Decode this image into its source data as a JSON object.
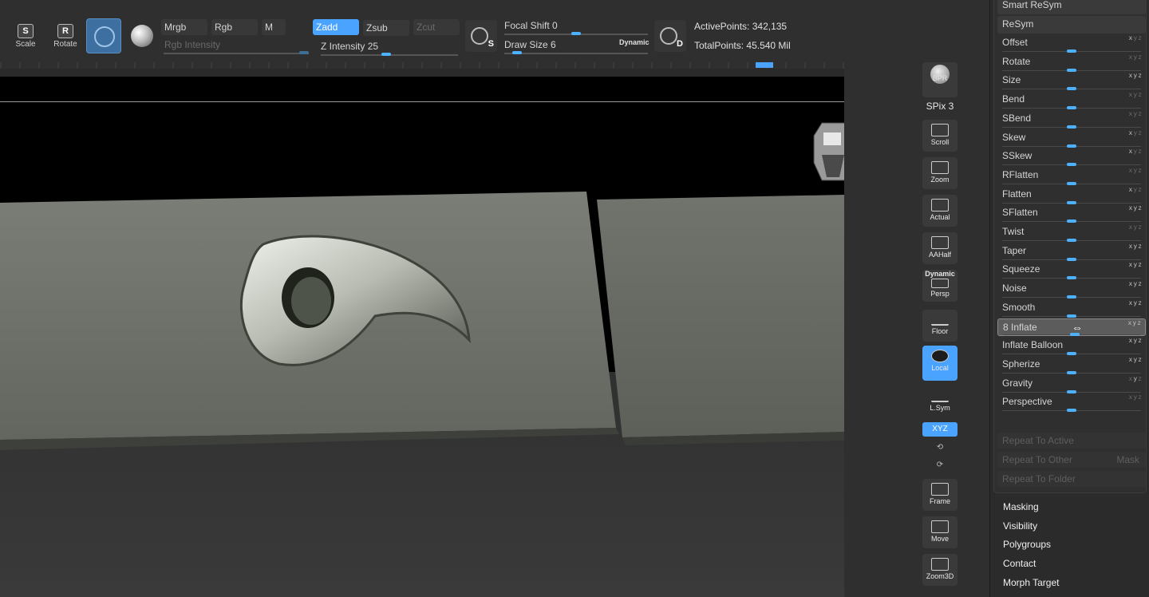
{
  "toolbar": {
    "scale_label": "Scale",
    "scale_glyph": "S",
    "rotate_label": "Rotate",
    "rotate_glyph": "R",
    "mrgb": "Mrgb",
    "rgb": "Rgb",
    "m": "M",
    "rgb_intensity": "Rgb Intensity",
    "zadd": "Zadd",
    "zsub": "Zsub",
    "zcut": "Zcut",
    "z_intensity_label": "Z Intensity",
    "z_intensity_value": "25",
    "focal_shift_label": "Focal Shift",
    "focal_shift_value": "0",
    "draw_size_label": "Draw Size",
    "draw_size_value": "6",
    "dynamic": "Dynamic",
    "brush_s_tag": "S",
    "brush_d_tag": "D",
    "active_points_label": "ActivePoints:",
    "active_points_value": "342,135",
    "total_points_label": "TotalPoints:",
    "total_points_value": "45.540 Mil"
  },
  "shelf": {
    "bpr": "BPR",
    "spix_label": "SPix",
    "spix_value": "3",
    "scroll": "Scroll",
    "zoom": "Zoom",
    "actual": "Actual",
    "aahalf": "AAHalf",
    "persp_top": "Dynamic",
    "persp": "Persp",
    "floor": "Floor",
    "local": "Local",
    "lsym": "L.Sym",
    "xyz": "XYZ",
    "frame": "Frame",
    "move": "Move",
    "zoom3d": "Zoom3D"
  },
  "deformation": {
    "top_items": [
      {
        "label": "Smart ReSym"
      },
      {
        "label": "ReSym"
      }
    ],
    "items": [
      {
        "label": "Offset",
        "axes": [
          "x",
          null,
          null
        ],
        "level": 0.5
      },
      {
        "label": "Rotate",
        "axes": [
          null,
          null,
          null
        ],
        "level": 0.5
      },
      {
        "label": "Size",
        "axes": [
          "x",
          "y",
          "z"
        ],
        "level": 0.5
      },
      {
        "label": "Bend",
        "axes": [
          null,
          null,
          null
        ],
        "level": 0.5
      },
      {
        "label": "SBend",
        "axes": [
          null,
          null,
          null
        ],
        "level": 0.5
      },
      {
        "label": "Skew",
        "axes": [
          "x",
          null,
          null
        ],
        "level": 0.5
      },
      {
        "label": "SSkew",
        "axes": [
          "x",
          null,
          null
        ],
        "level": 0.5
      },
      {
        "label": "RFlatten",
        "axes": [
          null,
          null,
          null
        ],
        "level": 0.5
      },
      {
        "label": "Flatten",
        "axes": [
          "x",
          null,
          null
        ],
        "level": 0.5
      },
      {
        "label": "SFlatten",
        "axes": [
          "x",
          "y",
          "z"
        ],
        "level": 0.5
      },
      {
        "label": "Twist",
        "axes": [
          null,
          null,
          null
        ],
        "level": 0.5
      },
      {
        "label": "Taper",
        "axes": [
          "x",
          "y",
          "z"
        ],
        "level": 0.5
      },
      {
        "label": "Squeeze",
        "axes": [
          "x",
          "y",
          "z"
        ],
        "level": 0.5
      },
      {
        "label": "Noise",
        "axes": [
          "x",
          "y",
          "z"
        ],
        "level": 0.5
      },
      {
        "label": "Smooth",
        "axes": [
          "x",
          "y",
          "z"
        ],
        "level": 0.5
      },
      {
        "label": "8 Inflate",
        "axes": [
          "x",
          "y",
          "z"
        ],
        "level": 0.52,
        "selected": true
      },
      {
        "label": "Inflate Balloon",
        "axes": [
          "x",
          "y",
          "z"
        ],
        "level": 0.5
      },
      {
        "label": "Spherize",
        "axes": [
          "x",
          "y",
          "z"
        ],
        "level": 0.5
      },
      {
        "label": "Gravity",
        "axes": [
          null,
          "y",
          null
        ],
        "level": 0.5
      },
      {
        "label": "Perspective",
        "axes": [
          null,
          null,
          null
        ],
        "level": 0.5
      }
    ],
    "repeat_active": "Repeat To Active",
    "repeat_other": "Repeat To Other",
    "mask": "Mask",
    "repeat_folder": "Repeat To Folder"
  },
  "sections": [
    "Masking",
    "Visibility",
    "Polygroups",
    "Contact",
    "Morph Target"
  ],
  "colors": {
    "accent": "#4aa3ff",
    "background": "#2a2a2a",
    "mesh": "#6f736b"
  }
}
